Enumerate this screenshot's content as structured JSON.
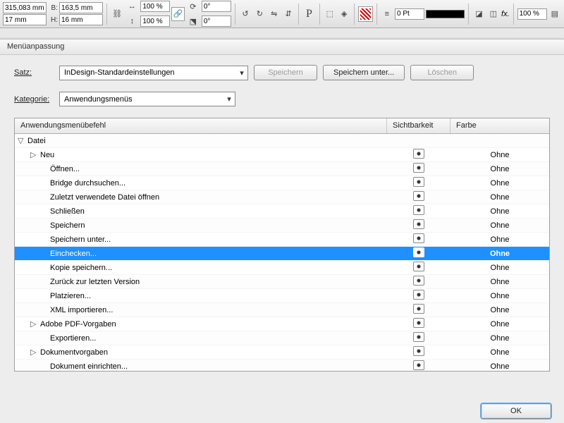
{
  "toolbar": {
    "x_value": "315,083 mm",
    "w_label": "B:",
    "w_value": "163,5 mm",
    "y_value": "17 mm",
    "h_label": "H:",
    "h_value": "16 mm",
    "scale_x": "100 %",
    "scale_y": "100 %",
    "rotate": "0°",
    "shear": "0°",
    "stroke_weight": "0 Pt",
    "opacity": "100 %",
    "fx_label": "fx."
  },
  "dialog": {
    "title": "Menüanpassung",
    "set_label": "Satz:",
    "set_value": "InDesign-Standardeinstellungen",
    "save_label": "Speichern",
    "saveas_label": "Speichern unter...",
    "delete_label": "Löschen",
    "category_label": "Kategorie:",
    "category_value": "Anwendungsmenüs",
    "col_command": "Anwendungsmenübefehl",
    "col_visibility": "Sichtbarkeit",
    "col_color": "Farbe",
    "ok_label": "OK"
  },
  "rows": [
    {
      "label": "Datei",
      "indent": 0,
      "expander": "▽",
      "visible": false,
      "color": ""
    },
    {
      "label": "Neu",
      "indent": 1,
      "expander": "▷",
      "visible": true,
      "color": "Ohne"
    },
    {
      "label": "Öffnen...",
      "indent": 2,
      "expander": "",
      "visible": true,
      "color": "Ohne"
    },
    {
      "label": "Bridge durchsuchen...",
      "indent": 2,
      "expander": "",
      "visible": true,
      "color": "Ohne"
    },
    {
      "label": "Zuletzt verwendete Datei öffnen",
      "indent": 2,
      "expander": "",
      "visible": true,
      "color": "Ohne"
    },
    {
      "label": "Schließen",
      "indent": 2,
      "expander": "",
      "visible": true,
      "color": "Ohne"
    },
    {
      "label": "Speichern",
      "indent": 2,
      "expander": "",
      "visible": true,
      "color": "Ohne"
    },
    {
      "label": "Speichern unter...",
      "indent": 2,
      "expander": "",
      "visible": true,
      "color": "Ohne"
    },
    {
      "label": "Einchecken...",
      "indent": 2,
      "expander": "",
      "visible": true,
      "color": "Ohne",
      "selected": true
    },
    {
      "label": "Kopie speichern...",
      "indent": 2,
      "expander": "",
      "visible": true,
      "color": "Ohne"
    },
    {
      "label": "Zurück zur letzten Version",
      "indent": 2,
      "expander": "",
      "visible": true,
      "color": "Ohne"
    },
    {
      "label": "Platzieren...",
      "indent": 2,
      "expander": "",
      "visible": true,
      "color": "Ohne"
    },
    {
      "label": "XML importieren...",
      "indent": 2,
      "expander": "",
      "visible": true,
      "color": "Ohne"
    },
    {
      "label": "Adobe PDF-Vorgaben",
      "indent": 1,
      "expander": "▷",
      "visible": true,
      "color": "Ohne"
    },
    {
      "label": "Exportieren...",
      "indent": 2,
      "expander": "",
      "visible": true,
      "color": "Ohne"
    },
    {
      "label": "Dokumentvorgaben",
      "indent": 1,
      "expander": "▷",
      "visible": true,
      "color": "Ohne"
    },
    {
      "label": "Dokument einrichten...",
      "indent": 2,
      "expander": "",
      "visible": true,
      "color": "Ohne"
    }
  ]
}
